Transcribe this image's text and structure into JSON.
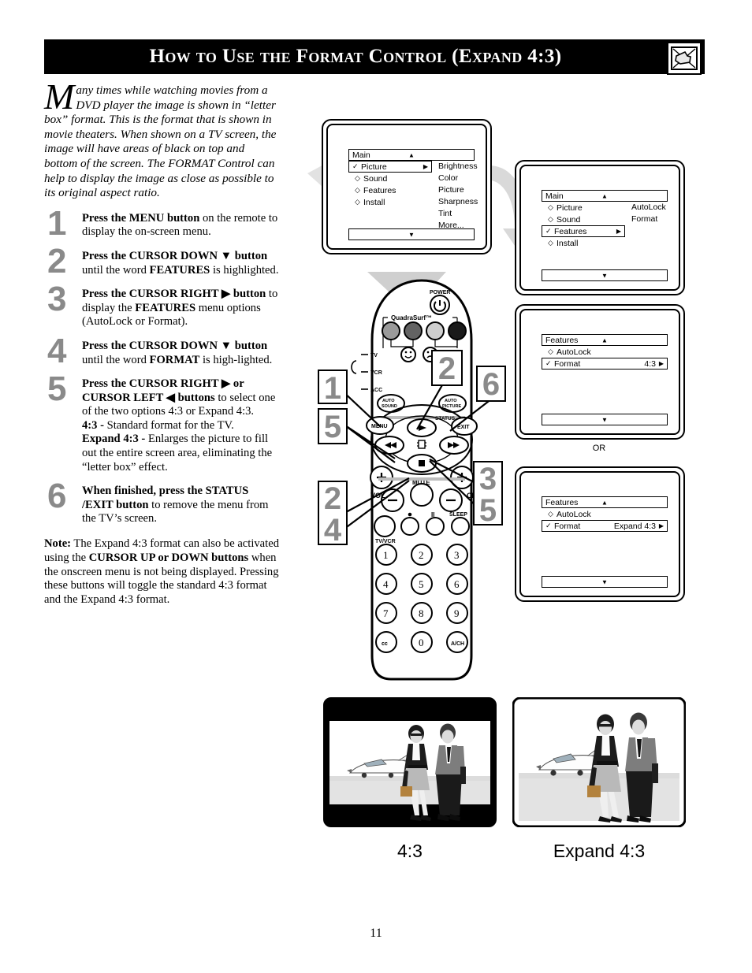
{
  "header": {
    "title": "How to Use the Format Control (Expand 4:3)",
    "icon": "hand-pointing-tv-icon"
  },
  "intro": {
    "dropcap": "M",
    "text": "any times while watching movies from a DVD player the image is shown in “letter box” format. This is the format that is shown in movie theaters. When shown on a TV screen, the image will have areas of black on top and bottom of the screen. The FORMAT Control can help to display the image as close as possible to its original aspect ratio."
  },
  "steps": [
    {
      "num": "1",
      "html": "<b>Press the MENU button</b> on the remote to display the on-screen menu."
    },
    {
      "num": "2",
      "html": "<b>Press the CURSOR DOWN ▼ button</b> until the word <b>FEATURES</b> is highlighted."
    },
    {
      "num": "3",
      "html": "<b>Press the CURSOR RIGHT ▶ button</b> to display the <b>FEATURES</b> menu options (AutoLock or Format)."
    },
    {
      "num": "4",
      "html": "<b>Press the CURSOR DOWN ▼ button</b> until the word <b>FORMAT</b> is high-lighted."
    },
    {
      "num": "5",
      "html": "<b>Press the CURSOR RIGHT ▶ or CURSOR LEFT ◀ buttons</b> to select one of the two options 4:3 or Expand 4:3.<br><b>4:3 -</b> Standard format for the TV.<br><b>Expand 4:3 -</b> Enlarges the picture to fill out the entire screen area, eliminating the “letter box” effect."
    },
    {
      "num": "6",
      "html": "<b>When finished, press the STATUS /EXIT button</b> to remove the menu from the TV’s screen."
    }
  ],
  "note": {
    "html": "<b>Note:</b> The Expand 4:3 format can also be activated using the <b>CURSOR UP or DOWN buttons</b> when the onscreen menu is not being displayed. Pressing these buttons will toggle the standard 4:3 format and the Expand 4:3 format."
  },
  "menus": {
    "screen1": {
      "title": "Main",
      "up_arrow": "▲",
      "down_arrow": "▼",
      "rows": [
        {
          "mark": "✓",
          "label": "Picture",
          "selected": true,
          "arrow": "▶"
        },
        {
          "mark": "◇",
          "label": "Sound",
          "selected": false,
          "arrow": ""
        },
        {
          "mark": "◇",
          "label": "Features",
          "selected": false,
          "arrow": ""
        },
        {
          "mark": "◇",
          "label": "Install",
          "selected": false,
          "arrow": ""
        }
      ],
      "submenu": [
        "Brightness",
        "Color",
        "Picture",
        "Sharpness",
        "Tint",
        "More..."
      ]
    },
    "screen2": {
      "title": "Main",
      "up_arrow": "▲",
      "down_arrow": "▼",
      "rows": [
        {
          "mark": "◇",
          "label": "Picture",
          "selected": false,
          "arrow": ""
        },
        {
          "mark": "◇",
          "label": "Sound",
          "selected": false,
          "arrow": ""
        },
        {
          "mark": "✓",
          "label": "Features",
          "selected": true,
          "arrow": "▶"
        },
        {
          "mark": "◇",
          "label": "Install",
          "selected": false,
          "arrow": ""
        }
      ],
      "submenu": [
        "AutoLock",
        "Format"
      ]
    },
    "screen3": {
      "title": "Features",
      "up_arrow": "▲",
      "down_arrow": "▼",
      "rows": [
        {
          "mark": "◇",
          "label": "AutoLock",
          "selected": false,
          "value": "",
          "arrow": ""
        },
        {
          "mark": "✓",
          "label": "Format",
          "selected": true,
          "value": "4:3",
          "arrow": "▶"
        }
      ]
    },
    "screen4": {
      "title": "Features",
      "up_arrow": "▲",
      "down_arrow": "▼",
      "rows": [
        {
          "mark": "◇",
          "label": "AutoLock",
          "selected": false,
          "value": "",
          "arrow": ""
        },
        {
          "mark": "✓",
          "label": "Format",
          "selected": true,
          "value": "Expand 4:3",
          "arrow": "▶"
        }
      ]
    },
    "or_label": "OR"
  },
  "remote": {
    "power_label": "POWER",
    "quadrasurf_label": "QuadraSurf™",
    "device_labels": [
      "TV",
      "VCR",
      "ACC"
    ],
    "auto_sound_label": "AUTO SOUND",
    "auto_picture_label": "AUTO PICTURE",
    "menu_label": "MENU",
    "status_label": "STATUS",
    "exit_label": "EXIT",
    "mute_label": "MUTE",
    "vol_label": "VOL",
    "ch_label": "CH",
    "sleep_label": "SLEEP",
    "tvvcr_label": "TV/VCR",
    "keypad": [
      "1",
      "2",
      "3",
      "4",
      "5",
      "6",
      "7",
      "8",
      "9",
      "cc",
      "0",
      "A/CH"
    ]
  },
  "callouts": [
    {
      "id": "c1",
      "label": "1"
    },
    {
      "id": "c2top",
      "label": "2"
    },
    {
      "id": "c6",
      "label": "6"
    },
    {
      "id": "c5",
      "label": "5"
    },
    {
      "id": "c24",
      "label": "2\n4"
    },
    {
      "id": "c35",
      "label": "3\n5"
    }
  ],
  "pictures": {
    "left_label": "4:3",
    "right_label": "Expand 4:3"
  },
  "page_number": "11",
  "colors": {
    "header_bg": "#000000",
    "callout_gray": "#8a8a8a",
    "arrow_gray": "#d4d4d4"
  }
}
